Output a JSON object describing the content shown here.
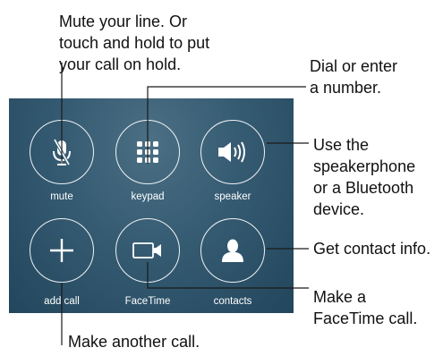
{
  "callouts": {
    "mute": [
      "Mute your line. Or",
      "touch and hold to put",
      "your call on hold."
    ],
    "keypad": [
      "Dial or enter",
      "a number."
    ],
    "speaker": [
      "Use the",
      "speakerphone",
      "or a Bluetooth",
      "device."
    ],
    "contacts": "Get contact info.",
    "facetime": [
      "Make a",
      "FaceTime call."
    ],
    "add_call": "Make another call."
  },
  "buttons": {
    "mute": "mute",
    "keypad": "keypad",
    "speaker": "speaker",
    "add_call": "add call",
    "facetime": "FaceTime",
    "contacts": "contacts"
  },
  "icons": {
    "mute": "microphone-muted-icon",
    "keypad": "keypad-grid-icon",
    "speaker": "speaker-icon",
    "add_call": "plus-icon",
    "facetime": "video-camera-icon",
    "contacts": "person-icon"
  },
  "colors": {
    "panel_background": "#2f5870",
    "button_outline": "#ffffff",
    "callout_text": "#111111"
  }
}
